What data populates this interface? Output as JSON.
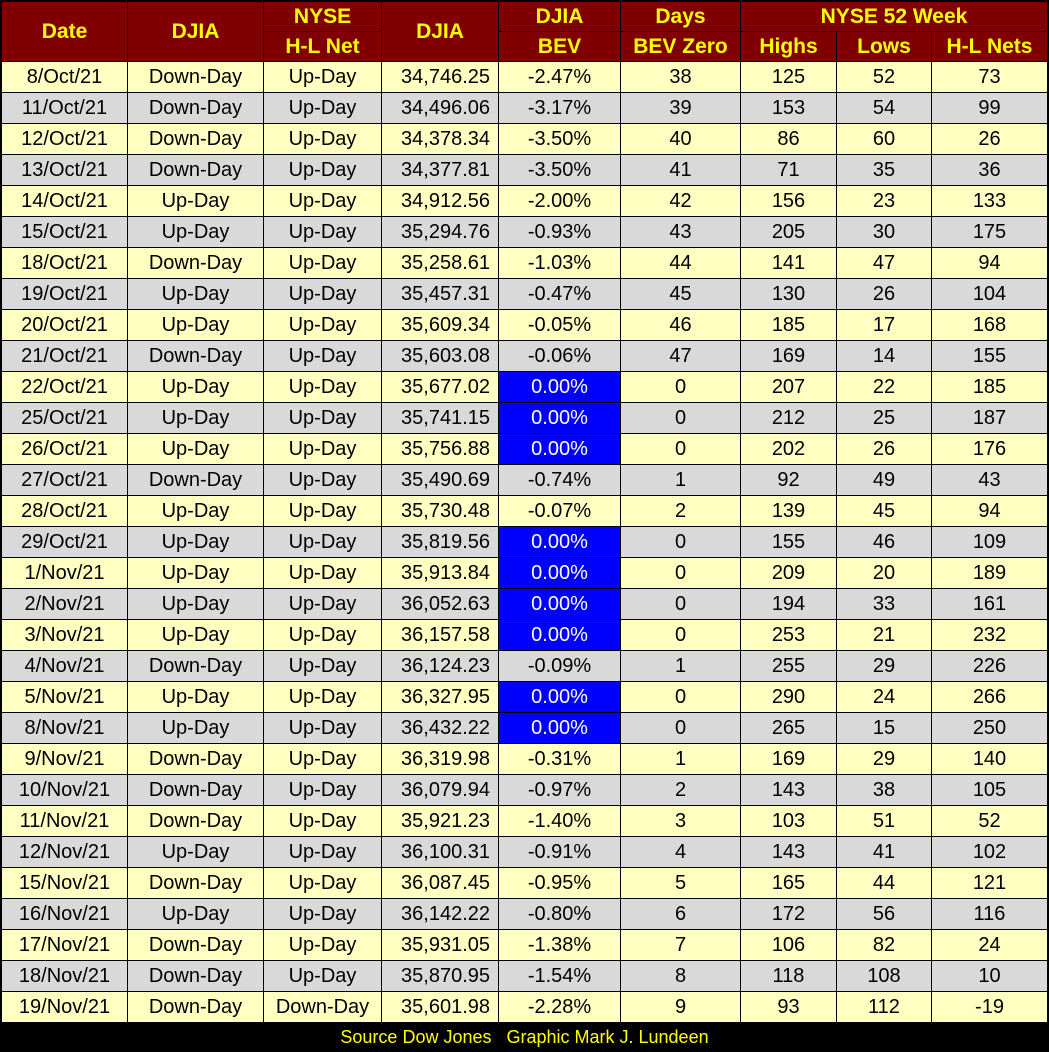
{
  "header": {
    "date": "Date",
    "djia_dir": "DJIA",
    "nyse_top": "NYSE",
    "nyse_bottom": "H-L Net",
    "djia_close": "DJIA",
    "bev_top": "DJIA",
    "bev_bottom": "BEV",
    "days_top": "Days",
    "days_bottom": "BEV Zero",
    "week52": "NYSE 52 Week",
    "highs": "Highs",
    "lows": "Lows",
    "nets": "H-L Nets"
  },
  "rows": [
    {
      "date": "8/Oct/21",
      "djia": "Down-Day",
      "nyse": "Up-Day",
      "close": "34,746.25",
      "bev": "-2.47%",
      "days": "38",
      "highs": "125",
      "lows": "52",
      "nets": "73",
      "zero": false
    },
    {
      "date": "11/Oct/21",
      "djia": "Down-Day",
      "nyse": "Up-Day",
      "close": "34,496.06",
      "bev": "-3.17%",
      "days": "39",
      "highs": "153",
      "lows": "54",
      "nets": "99",
      "zero": false
    },
    {
      "date": "12/Oct/21",
      "djia": "Down-Day",
      "nyse": "Up-Day",
      "close": "34,378.34",
      "bev": "-3.50%",
      "days": "40",
      "highs": "86",
      "lows": "60",
      "nets": "26",
      "zero": false
    },
    {
      "date": "13/Oct/21",
      "djia": "Down-Day",
      "nyse": "Up-Day",
      "close": "34,377.81",
      "bev": "-3.50%",
      "days": "41",
      "highs": "71",
      "lows": "35",
      "nets": "36",
      "zero": false
    },
    {
      "date": "14/Oct/21",
      "djia": "Up-Day",
      "nyse": "Up-Day",
      "close": "34,912.56",
      "bev": "-2.00%",
      "days": "42",
      "highs": "156",
      "lows": "23",
      "nets": "133",
      "zero": false
    },
    {
      "date": "15/Oct/21",
      "djia": "Up-Day",
      "nyse": "Up-Day",
      "close": "35,294.76",
      "bev": "-0.93%",
      "days": "43",
      "highs": "205",
      "lows": "30",
      "nets": "175",
      "zero": false
    },
    {
      "date": "18/Oct/21",
      "djia": "Down-Day",
      "nyse": "Up-Day",
      "close": "35,258.61",
      "bev": "-1.03%",
      "days": "44",
      "highs": "141",
      "lows": "47",
      "nets": "94",
      "zero": false
    },
    {
      "date": "19/Oct/21",
      "djia": "Up-Day",
      "nyse": "Up-Day",
      "close": "35,457.31",
      "bev": "-0.47%",
      "days": "45",
      "highs": "130",
      "lows": "26",
      "nets": "104",
      "zero": false
    },
    {
      "date": "20/Oct/21",
      "djia": "Up-Day",
      "nyse": "Up-Day",
      "close": "35,609.34",
      "bev": "-0.05%",
      "days": "46",
      "highs": "185",
      "lows": "17",
      "nets": "168",
      "zero": false
    },
    {
      "date": "21/Oct/21",
      "djia": "Down-Day",
      "nyse": "Up-Day",
      "close": "35,603.08",
      "bev": "-0.06%",
      "days": "47",
      "highs": "169",
      "lows": "14",
      "nets": "155",
      "zero": false
    },
    {
      "date": "22/Oct/21",
      "djia": "Up-Day",
      "nyse": "Up-Day",
      "close": "35,677.02",
      "bev": "0.00%",
      "days": "0",
      "highs": "207",
      "lows": "22",
      "nets": "185",
      "zero": true
    },
    {
      "date": "25/Oct/21",
      "djia": "Up-Day",
      "nyse": "Up-Day",
      "close": "35,741.15",
      "bev": "0.00%",
      "days": "0",
      "highs": "212",
      "lows": "25",
      "nets": "187",
      "zero": true
    },
    {
      "date": "26/Oct/21",
      "djia": "Up-Day",
      "nyse": "Up-Day",
      "close": "35,756.88",
      "bev": "0.00%",
      "days": "0",
      "highs": "202",
      "lows": "26",
      "nets": "176",
      "zero": true
    },
    {
      "date": "27/Oct/21",
      "djia": "Down-Day",
      "nyse": "Up-Day",
      "close": "35,490.69",
      "bev": "-0.74%",
      "days": "1",
      "highs": "92",
      "lows": "49",
      "nets": "43",
      "zero": false
    },
    {
      "date": "28/Oct/21",
      "djia": "Up-Day",
      "nyse": "Up-Day",
      "close": "35,730.48",
      "bev": "-0.07%",
      "days": "2",
      "highs": "139",
      "lows": "45",
      "nets": "94",
      "zero": false
    },
    {
      "date": "29/Oct/21",
      "djia": "Up-Day",
      "nyse": "Up-Day",
      "close": "35,819.56",
      "bev": "0.00%",
      "days": "0",
      "highs": "155",
      "lows": "46",
      "nets": "109",
      "zero": true
    },
    {
      "date": "1/Nov/21",
      "djia": "Up-Day",
      "nyse": "Up-Day",
      "close": "35,913.84",
      "bev": "0.00%",
      "days": "0",
      "highs": "209",
      "lows": "20",
      "nets": "189",
      "zero": true
    },
    {
      "date": "2/Nov/21",
      "djia": "Up-Day",
      "nyse": "Up-Day",
      "close": "36,052.63",
      "bev": "0.00%",
      "days": "0",
      "highs": "194",
      "lows": "33",
      "nets": "161",
      "zero": true
    },
    {
      "date": "3/Nov/21",
      "djia": "Up-Day",
      "nyse": "Up-Day",
      "close": "36,157.58",
      "bev": "0.00%",
      "days": "0",
      "highs": "253",
      "lows": "21",
      "nets": "232",
      "zero": true
    },
    {
      "date": "4/Nov/21",
      "djia": "Down-Day",
      "nyse": "Up-Day",
      "close": "36,124.23",
      "bev": "-0.09%",
      "days": "1",
      "highs": "255",
      "lows": "29",
      "nets": "226",
      "zero": false
    },
    {
      "date": "5/Nov/21",
      "djia": "Up-Day",
      "nyse": "Up-Day",
      "close": "36,327.95",
      "bev": "0.00%",
      "days": "0",
      "highs": "290",
      "lows": "24",
      "nets": "266",
      "zero": true
    },
    {
      "date": "8/Nov/21",
      "djia": "Up-Day",
      "nyse": "Up-Day",
      "close": "36,432.22",
      "bev": "0.00%",
      "days": "0",
      "highs": "265",
      "lows": "15",
      "nets": "250",
      "zero": true
    },
    {
      "date": "9/Nov/21",
      "djia": "Down-Day",
      "nyse": "Up-Day",
      "close": "36,319.98",
      "bev": "-0.31%",
      "days": "1",
      "highs": "169",
      "lows": "29",
      "nets": "140",
      "zero": false
    },
    {
      "date": "10/Nov/21",
      "djia": "Down-Day",
      "nyse": "Up-Day",
      "close": "36,079.94",
      "bev": "-0.97%",
      "days": "2",
      "highs": "143",
      "lows": "38",
      "nets": "105",
      "zero": false
    },
    {
      "date": "11/Nov/21",
      "djia": "Down-Day",
      "nyse": "Up-Day",
      "close": "35,921.23",
      "bev": "-1.40%",
      "days": "3",
      "highs": "103",
      "lows": "51",
      "nets": "52",
      "zero": false
    },
    {
      "date": "12/Nov/21",
      "djia": "Up-Day",
      "nyse": "Up-Day",
      "close": "36,100.31",
      "bev": "-0.91%",
      "days": "4",
      "highs": "143",
      "lows": "41",
      "nets": "102",
      "zero": false
    },
    {
      "date": "15/Nov/21",
      "djia": "Down-Day",
      "nyse": "Up-Day",
      "close": "36,087.45",
      "bev": "-0.95%",
      "days": "5",
      "highs": "165",
      "lows": "44",
      "nets": "121",
      "zero": false
    },
    {
      "date": "16/Nov/21",
      "djia": "Up-Day",
      "nyse": "Up-Day",
      "close": "36,142.22",
      "bev": "-0.80%",
      "days": "6",
      "highs": "172",
      "lows": "56",
      "nets": "116",
      "zero": false
    },
    {
      "date": "17/Nov/21",
      "djia": "Down-Day",
      "nyse": "Up-Day",
      "close": "35,931.05",
      "bev": "-1.38%",
      "days": "7",
      "highs": "106",
      "lows": "82",
      "nets": "24",
      "zero": false
    },
    {
      "date": "18/Nov/21",
      "djia": "Down-Day",
      "nyse": "Up-Day",
      "close": "35,870.95",
      "bev": "-1.54%",
      "days": "8",
      "highs": "118",
      "lows": "108",
      "nets": "10",
      "zero": false
    },
    {
      "date": "19/Nov/21",
      "djia": "Down-Day",
      "nyse": "Down-Day",
      "close": "35,601.98",
      "bev": "-2.28%",
      "days": "9",
      "highs": "93",
      "lows": "112",
      "nets": "-19",
      "zero": false
    }
  ],
  "footer": "Source Dow Jones   Graphic Mark J. Lundeen",
  "colors": {
    "header_bg": "#800000",
    "header_text": "#ffff00",
    "row_odd": "#ffffc2",
    "row_even": "#d9d9d9",
    "bev_zero": "#0000ff"
  }
}
